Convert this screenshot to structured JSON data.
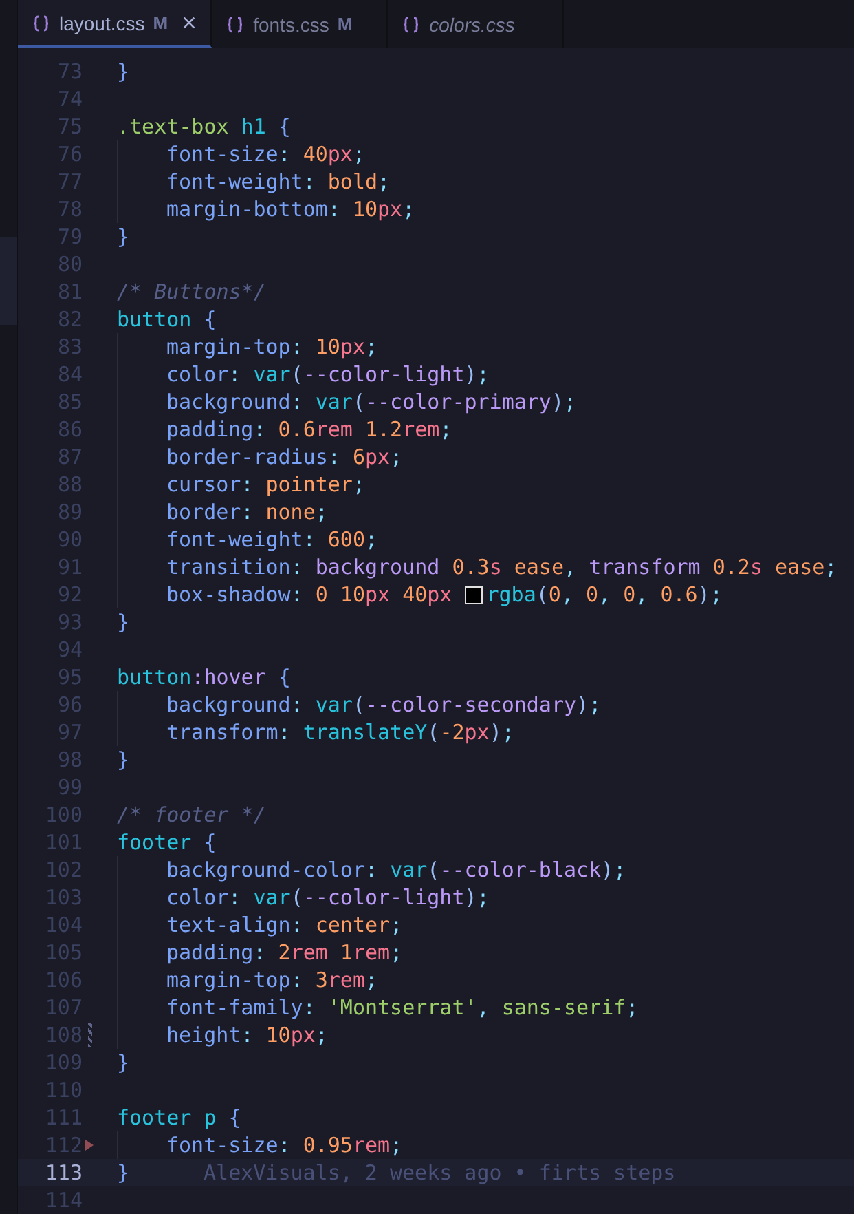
{
  "tabs": [
    {
      "label": "layout.css",
      "status": "M",
      "selected": true,
      "preview": false,
      "closable": true
    },
    {
      "label": "fonts.css",
      "status": "M",
      "selected": false,
      "preview": false,
      "closable": false
    },
    {
      "label": "colors.css",
      "selected": false,
      "preview": true,
      "closable": false
    }
  ],
  "lines": [
    {
      "number": "73",
      "current": false,
      "tokens": [
        {
          "kind": "brace",
          "text": "}"
        }
      ]
    },
    {
      "number": "74",
      "current": false
    },
    {
      "number": "75",
      "current": false,
      "tokens": [
        {
          "kind": "cls",
          "text": ".text-box"
        },
        {
          "kind": "tag",
          "text": " h1"
        },
        {
          "kind": "brace",
          "text": " {"
        }
      ]
    },
    {
      "number": "76",
      "current": false,
      "tokens": [
        {
          "kind": "indent"
        },
        {
          "kind": "prop",
          "text": "font-size"
        },
        {
          "kind": "punct",
          "text": ": "
        },
        {
          "kind": "num",
          "text": "40"
        },
        {
          "kind": "unit",
          "text": "px"
        },
        {
          "kind": "punct",
          "text": ";"
        }
      ]
    },
    {
      "number": "77",
      "current": false,
      "tokens": [
        {
          "kind": "indent"
        },
        {
          "kind": "prop",
          "text": "font-weight"
        },
        {
          "kind": "punct",
          "text": ": "
        },
        {
          "kind": "kw",
          "text": "bold"
        },
        {
          "kind": "punct",
          "text": ";"
        }
      ]
    },
    {
      "number": "78",
      "current": false,
      "tokens": [
        {
          "kind": "indent"
        },
        {
          "kind": "prop",
          "text": "margin-bottom"
        },
        {
          "kind": "punct",
          "text": ": "
        },
        {
          "kind": "num",
          "text": "10"
        },
        {
          "kind": "unit",
          "text": "px"
        },
        {
          "kind": "punct",
          "text": ";"
        }
      ]
    },
    {
      "number": "79",
      "current": false,
      "tokens": [
        {
          "kind": "brace",
          "text": "}"
        }
      ]
    },
    {
      "number": "80",
      "current": false
    },
    {
      "number": "81",
      "current": false,
      "tokens": [
        {
          "kind": "comment",
          "text": "/* Buttons*/"
        }
      ]
    },
    {
      "number": "82",
      "current": false,
      "tokens": [
        {
          "kind": "tag",
          "text": "button"
        },
        {
          "kind": "brace",
          "text": " {"
        }
      ]
    },
    {
      "number": "83",
      "current": false,
      "tokens": [
        {
          "kind": "indent"
        },
        {
          "kind": "prop",
          "text": "margin-top"
        },
        {
          "kind": "punct",
          "text": ": "
        },
        {
          "kind": "num",
          "text": "10"
        },
        {
          "kind": "unit",
          "text": "px"
        },
        {
          "kind": "punct",
          "text": ";"
        }
      ]
    },
    {
      "number": "84",
      "current": false,
      "tokens": [
        {
          "kind": "indent"
        },
        {
          "kind": "prop",
          "text": "color"
        },
        {
          "kind": "punct",
          "text": ": "
        },
        {
          "kind": "fn",
          "text": "var"
        },
        {
          "kind": "paren",
          "text": "("
        },
        {
          "kind": "var",
          "text": "--color-light"
        },
        {
          "kind": "paren",
          "text": ")"
        },
        {
          "kind": "punct",
          "text": ";"
        }
      ]
    },
    {
      "number": "85",
      "current": false,
      "tokens": [
        {
          "kind": "indent"
        },
        {
          "kind": "prop",
          "text": "background"
        },
        {
          "kind": "punct",
          "text": ": "
        },
        {
          "kind": "fn",
          "text": "var"
        },
        {
          "kind": "paren",
          "text": "("
        },
        {
          "kind": "var",
          "text": "--color-primary"
        },
        {
          "kind": "paren",
          "text": ")"
        },
        {
          "kind": "punct",
          "text": ";"
        }
      ]
    },
    {
      "number": "86",
      "current": false,
      "tokens": [
        {
          "kind": "indent"
        },
        {
          "kind": "prop",
          "text": "padding"
        },
        {
          "kind": "punct",
          "text": ": "
        },
        {
          "kind": "num",
          "text": "0.6"
        },
        {
          "kind": "unit",
          "text": "rem"
        },
        {
          "kind": "num",
          "text": " 1.2"
        },
        {
          "kind": "unit",
          "text": "rem"
        },
        {
          "kind": "punct",
          "text": ";"
        }
      ]
    },
    {
      "number": "87",
      "current": false,
      "tokens": [
        {
          "kind": "indent"
        },
        {
          "kind": "prop",
          "text": "border-radius"
        },
        {
          "kind": "punct",
          "text": ": "
        },
        {
          "kind": "num",
          "text": "6"
        },
        {
          "kind": "unit",
          "text": "px"
        },
        {
          "kind": "punct",
          "text": ";"
        }
      ]
    },
    {
      "number": "88",
      "current": false,
      "tokens": [
        {
          "kind": "indent"
        },
        {
          "kind": "prop",
          "text": "cursor"
        },
        {
          "kind": "punct",
          "text": ": "
        },
        {
          "kind": "kw",
          "text": "pointer"
        },
        {
          "kind": "punct",
          "text": ";"
        }
      ]
    },
    {
      "number": "89",
      "current": false,
      "tokens": [
        {
          "kind": "indent"
        },
        {
          "kind": "prop",
          "text": "border"
        },
        {
          "kind": "punct",
          "text": ": "
        },
        {
          "kind": "kw",
          "text": "none"
        },
        {
          "kind": "punct",
          "text": ";"
        }
      ]
    },
    {
      "number": "90",
      "current": false,
      "tokens": [
        {
          "kind": "indent"
        },
        {
          "kind": "prop",
          "text": "font-weight"
        },
        {
          "kind": "punct",
          "text": ": "
        },
        {
          "kind": "num",
          "text": "600"
        },
        {
          "kind": "punct",
          "text": ";"
        }
      ]
    },
    {
      "number": "91",
      "current": false,
      "tokens": [
        {
          "kind": "indent"
        },
        {
          "kind": "prop",
          "text": "transition"
        },
        {
          "kind": "punct",
          "text": ": "
        },
        {
          "kind": "ident",
          "text": "background"
        },
        {
          "kind": "num",
          "text": " 0.3"
        },
        {
          "kind": "unit",
          "text": "s"
        },
        {
          "kind": "kw",
          "text": " ease"
        },
        {
          "kind": "punct",
          "text": ", "
        },
        {
          "kind": "ident",
          "text": "transform"
        },
        {
          "kind": "num",
          "text": " 0.2"
        },
        {
          "kind": "unit",
          "text": "s"
        },
        {
          "kind": "kw",
          "text": " ease"
        },
        {
          "kind": "punct",
          "text": ";"
        }
      ]
    },
    {
      "number": "92",
      "current": false,
      "tokens": [
        {
          "kind": "indent"
        },
        {
          "kind": "prop",
          "text": "box-shadow"
        },
        {
          "kind": "punct",
          "text": ": "
        },
        {
          "kind": "num",
          "text": "0 10"
        },
        {
          "kind": "unit",
          "text": "px"
        },
        {
          "kind": "num",
          "text": " 40"
        },
        {
          "kind": "unit",
          "text": "px "
        },
        {
          "kind": "swatch",
          "color": "#000000"
        },
        {
          "kind": "fn",
          "text": "rgba"
        },
        {
          "kind": "paren",
          "text": "("
        },
        {
          "kind": "num",
          "text": "0"
        },
        {
          "kind": "punct",
          "text": ", "
        },
        {
          "kind": "num",
          "text": "0"
        },
        {
          "kind": "punct",
          "text": ", "
        },
        {
          "kind": "num",
          "text": "0"
        },
        {
          "kind": "punct",
          "text": ", "
        },
        {
          "kind": "num",
          "text": "0.6"
        },
        {
          "kind": "paren",
          "text": ")"
        },
        {
          "kind": "punct",
          "text": ";"
        }
      ]
    },
    {
      "number": "93",
      "current": false,
      "tokens": [
        {
          "kind": "brace",
          "text": "}"
        }
      ]
    },
    {
      "number": "94",
      "current": false
    },
    {
      "number": "95",
      "current": false,
      "tokens": [
        {
          "kind": "tag",
          "text": "button"
        },
        {
          "kind": "pseudo",
          "text": ":hover"
        },
        {
          "kind": "brace",
          "text": " {"
        }
      ]
    },
    {
      "number": "96",
      "current": false,
      "tokens": [
        {
          "kind": "indent"
        },
        {
          "kind": "prop",
          "text": "background"
        },
        {
          "kind": "punct",
          "text": ": "
        },
        {
          "kind": "fn",
          "text": "var"
        },
        {
          "kind": "paren",
          "text": "("
        },
        {
          "kind": "var",
          "text": "--color-secondary"
        },
        {
          "kind": "paren",
          "text": ")"
        },
        {
          "kind": "punct",
          "text": ";"
        }
      ]
    },
    {
      "number": "97",
      "current": false,
      "tokens": [
        {
          "kind": "indent"
        },
        {
          "kind": "prop",
          "text": "transform"
        },
        {
          "kind": "punct",
          "text": ": "
        },
        {
          "kind": "fn",
          "text": "translateY"
        },
        {
          "kind": "paren",
          "text": "("
        },
        {
          "kind": "num",
          "text": "-2"
        },
        {
          "kind": "unit",
          "text": "px"
        },
        {
          "kind": "paren",
          "text": ")"
        },
        {
          "kind": "punct",
          "text": ";"
        }
      ]
    },
    {
      "number": "98",
      "current": false,
      "tokens": [
        {
          "kind": "brace",
          "text": "}"
        }
      ]
    },
    {
      "number": "99",
      "current": false
    },
    {
      "number": "100",
      "current": false,
      "tokens": [
        {
          "kind": "comment",
          "text": "/* footer */"
        }
      ]
    },
    {
      "number": "101",
      "current": false,
      "tokens": [
        {
          "kind": "tag",
          "text": "footer"
        },
        {
          "kind": "brace",
          "text": " {"
        }
      ]
    },
    {
      "number": "102",
      "current": false,
      "tokens": [
        {
          "kind": "indent"
        },
        {
          "kind": "prop",
          "text": "background-color"
        },
        {
          "kind": "punct",
          "text": ": "
        },
        {
          "kind": "fn",
          "text": "var"
        },
        {
          "kind": "paren",
          "text": "("
        },
        {
          "kind": "var",
          "text": "--color-black"
        },
        {
          "kind": "paren",
          "text": ")"
        },
        {
          "kind": "punct",
          "text": ";"
        }
      ]
    },
    {
      "number": "103",
      "current": false,
      "tokens": [
        {
          "kind": "indent"
        },
        {
          "kind": "prop",
          "text": "color"
        },
        {
          "kind": "punct",
          "text": ": "
        },
        {
          "kind": "fn",
          "text": "var"
        },
        {
          "kind": "paren",
          "text": "("
        },
        {
          "kind": "var",
          "text": "--color-light"
        },
        {
          "kind": "paren",
          "text": ")"
        },
        {
          "kind": "punct",
          "text": ";"
        }
      ]
    },
    {
      "number": "104",
      "current": false,
      "tokens": [
        {
          "kind": "indent"
        },
        {
          "kind": "prop",
          "text": "text-align"
        },
        {
          "kind": "punct",
          "text": ": "
        },
        {
          "kind": "kw",
          "text": "center"
        },
        {
          "kind": "punct",
          "text": ";"
        }
      ]
    },
    {
      "number": "105",
      "current": false,
      "tokens": [
        {
          "kind": "indent"
        },
        {
          "kind": "prop",
          "text": "padding"
        },
        {
          "kind": "punct",
          "text": ": "
        },
        {
          "kind": "num",
          "text": "2"
        },
        {
          "kind": "unit",
          "text": "rem"
        },
        {
          "kind": "num",
          "text": " 1"
        },
        {
          "kind": "unit",
          "text": "rem"
        },
        {
          "kind": "punct",
          "text": ";"
        }
      ]
    },
    {
      "number": "106",
      "current": false,
      "tokens": [
        {
          "kind": "indent"
        },
        {
          "kind": "prop",
          "text": "margin-top"
        },
        {
          "kind": "punct",
          "text": ": "
        },
        {
          "kind": "num",
          "text": "3"
        },
        {
          "kind": "unit",
          "text": "rem"
        },
        {
          "kind": "punct",
          "text": ";"
        }
      ]
    },
    {
      "number": "107",
      "current": false,
      "tokens": [
        {
          "kind": "indent"
        },
        {
          "kind": "prop",
          "text": "font-family"
        },
        {
          "kind": "punct",
          "text": ": "
        },
        {
          "kind": "str",
          "text": "'Montserrat'"
        },
        {
          "kind": "punct",
          "text": ", "
        },
        {
          "kind": "str",
          "text": "sans-serif"
        },
        {
          "kind": "punct",
          "text": ";"
        }
      ]
    },
    {
      "number": "108",
      "current": false,
      "marker": {
        "kind": "modified"
      },
      "tokens": [
        {
          "kind": "indent"
        },
        {
          "kind": "prop",
          "text": "height"
        },
        {
          "kind": "punct",
          "text": ": "
        },
        {
          "kind": "num",
          "text": "10"
        },
        {
          "kind": "unit",
          "text": "px"
        },
        {
          "kind": "punct",
          "text": ";"
        }
      ]
    },
    {
      "number": "109",
      "current": false,
      "tokens": [
        {
          "kind": "brace",
          "text": "}"
        }
      ]
    },
    {
      "number": "110",
      "current": false
    },
    {
      "number": "111",
      "current": false,
      "tokens": [
        {
          "kind": "tag",
          "text": "footer p"
        },
        {
          "kind": "brace",
          "text": " {"
        }
      ]
    },
    {
      "number": "112",
      "current": false,
      "marker": {
        "kind": "deleted"
      },
      "tokens": [
        {
          "kind": "indent"
        },
        {
          "kind": "prop",
          "text": "font-size"
        },
        {
          "kind": "punct",
          "text": ": "
        },
        {
          "kind": "num",
          "text": "0.95"
        },
        {
          "kind": "unit",
          "text": "rem"
        },
        {
          "kind": "punct",
          "text": ";"
        }
      ]
    },
    {
      "number": "113",
      "current": true,
      "blame": "AlexVisuals, 2 weeks ago • firts steps",
      "tokens": [
        {
          "kind": "brace",
          "text": "}"
        }
      ]
    },
    {
      "number": "114",
      "current": false
    }
  ]
}
